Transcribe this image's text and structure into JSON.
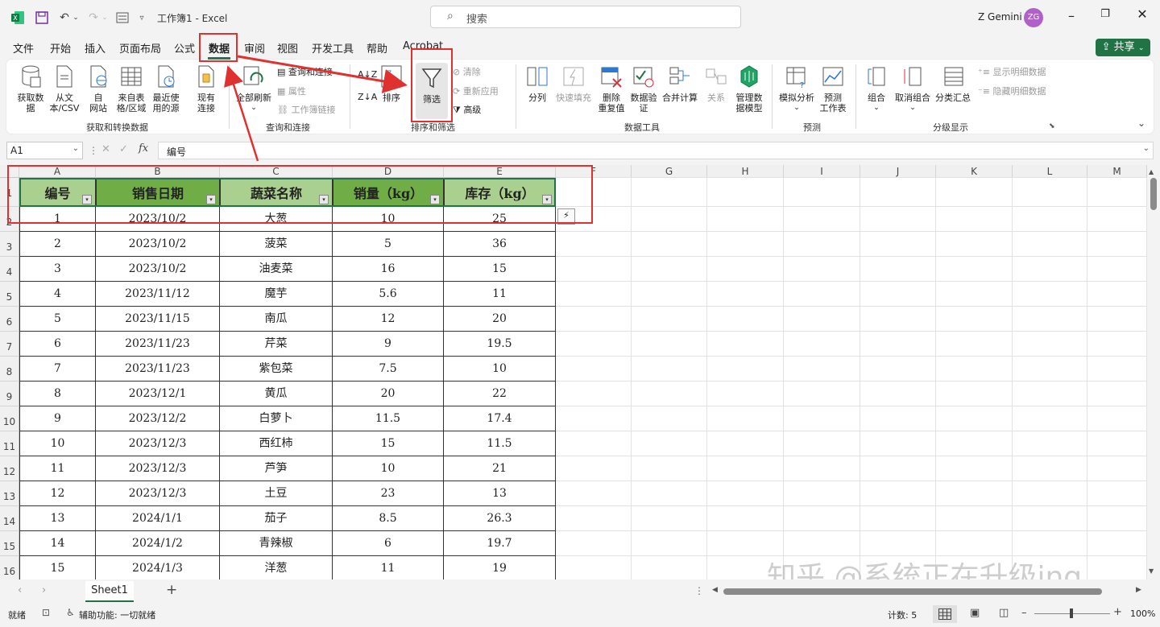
{
  "titlebar": {
    "title": "工作簿1  -  Excel",
    "search_placeholder": "搜索",
    "user_name": "Z Gemini",
    "avatar_initials": "ZG",
    "accent": "#217346"
  },
  "tabs": [
    "文件",
    "开始",
    "插入",
    "页面布局",
    "公式",
    "数据",
    "审阅",
    "视图",
    "开发工具",
    "帮助",
    "Acrobat"
  ],
  "share_label": "共享",
  "ribbon": {
    "get_data": [
      "获取数据",
      "从文本/CSV",
      "自网站",
      "来自表格/区域",
      "最近使用的源",
      "现有连接"
    ],
    "get_data_labels": [
      "获取数\n据",
      "从文\n本/CSV",
      "自\n网站",
      "来自表\n格/区域",
      "最近使\n用的源",
      "现有\n连接"
    ],
    "group_get": "获取和转换数据",
    "refresh_all": "全部刷新",
    "queries_small": [
      "查询和连接",
      "属性",
      "工作簿链接"
    ],
    "group_query": "查询和连接",
    "sort": "排序",
    "filter": "筛选",
    "filter_small": [
      "清除",
      "重新应用",
      "高级"
    ],
    "group_sort": "排序和筛选",
    "tools": [
      "分列",
      "快速填充",
      "删除\n重复值",
      "数据验\n证",
      "合并计算",
      "关系",
      "管理数\n据模型"
    ],
    "group_tools": "数据工具",
    "forecast": [
      "模拟分析",
      "预测\n工作表"
    ],
    "group_forecast": "预测",
    "outline": [
      "组合",
      "取消组合",
      "分类汇总"
    ],
    "outline_small": [
      "显示明细数据",
      "隐藏明细数据"
    ],
    "group_outline": "分级显示"
  },
  "formula": {
    "name_box": "A1",
    "fx": "fx",
    "content": "编号"
  },
  "columns": [
    "A",
    "B",
    "C",
    "D",
    "E",
    "F",
    "G",
    "H",
    "I",
    "J",
    "K",
    "L",
    "M"
  ],
  "table": {
    "headers": [
      "编号",
      "销售日期",
      "蔬菜名称",
      "销量（kg）",
      "库存（kg）"
    ],
    "rows": [
      [
        "1",
        "2023/10/2",
        "大葱",
        "10",
        "25"
      ],
      [
        "2",
        "2023/10/2",
        "菠菜",
        "5",
        "36"
      ],
      [
        "3",
        "2023/10/2",
        "油麦菜",
        "16",
        "15"
      ],
      [
        "4",
        "2023/11/12",
        "魔芋",
        "5.6",
        "11"
      ],
      [
        "5",
        "2023/11/15",
        "南瓜",
        "12",
        "20"
      ],
      [
        "6",
        "2023/11/23",
        "芹菜",
        "9",
        "19.5"
      ],
      [
        "7",
        "2023/11/23",
        "紫包菜",
        "7.5",
        "10"
      ],
      [
        "8",
        "2023/12/1",
        "黄瓜",
        "20",
        "22"
      ],
      [
        "9",
        "2023/12/2",
        "白萝卜",
        "11.5",
        "17.4"
      ],
      [
        "10",
        "2023/12/3",
        "西红柿",
        "15",
        "11.5"
      ],
      [
        "11",
        "2023/12/3",
        "芦笋",
        "10",
        "21"
      ],
      [
        "12",
        "2023/12/3",
        "土豆",
        "23",
        "13"
      ],
      [
        "13",
        "2024/1/1",
        "茄子",
        "8.5",
        "26.3"
      ],
      [
        "14",
        "2024/1/2",
        "青辣椒",
        "6",
        "19.7"
      ],
      [
        "15",
        "2024/1/3",
        "洋葱",
        "11",
        "19"
      ]
    ]
  },
  "row_numbers": [
    "1",
    "2",
    "3",
    "4",
    "5",
    "6",
    "7",
    "8",
    "9",
    "10",
    "11",
    "12",
    "13",
    "14",
    "15",
    "16"
  ],
  "sheet_tab": "Sheet1",
  "status": {
    "ready": "就绪",
    "accessibility": "辅助功能: 一切就绪",
    "count": "计数: 5",
    "zoom": "100%"
  },
  "watermark": "知乎 @系统正在升级ing"
}
